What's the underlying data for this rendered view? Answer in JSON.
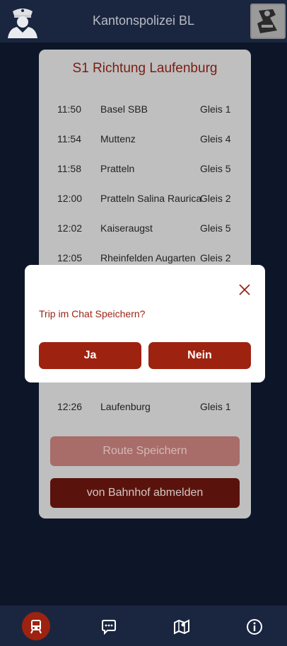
{
  "header": {
    "title": "Kantonspolizei BL"
  },
  "card": {
    "title": "S1 Richtung Laufenburg",
    "stops": [
      {
        "time": "11:50",
        "station": "Basel SBB",
        "gleis": "Gleis 1"
      },
      {
        "time": "11:54",
        "station": "Muttenz",
        "gleis": "Gleis 4"
      },
      {
        "time": "11:58",
        "station": "Pratteln",
        "gleis": "Gleis 5"
      },
      {
        "time": "12:00",
        "station": "Pratteln Salina Raurica",
        "gleis": "Gleis 2"
      },
      {
        "time": "12:02",
        "station": "Kaiseraugst",
        "gleis": "Gleis 5"
      },
      {
        "time": "12:05",
        "station": "Rheinfelden Augarten",
        "gleis": "Gleis 2"
      },
      {
        "time": "12:26",
        "station": "Laufenburg",
        "gleis": "Gleis 1"
      }
    ],
    "save_route_label": "Route Speichern",
    "checkout_label": "von Bahnhof abmelden"
  },
  "modal": {
    "question": "Trip im Chat Speichern?",
    "yes_label": "Ja",
    "no_label": "Nein"
  },
  "nav": {
    "active": "train",
    "items": [
      "train",
      "chat",
      "map",
      "info"
    ]
  },
  "colors": {
    "background": "#0d1629",
    "header": "#1a2640",
    "accent": "#9e2210",
    "modal_text": "#9b2414"
  },
  "icons": {
    "avatar": "police-officer-icon",
    "logo": "kantonspolizei-logo",
    "close": "close-icon",
    "train": "train-icon",
    "chat": "chat-icon",
    "map": "map-icon",
    "info": "info-icon"
  }
}
